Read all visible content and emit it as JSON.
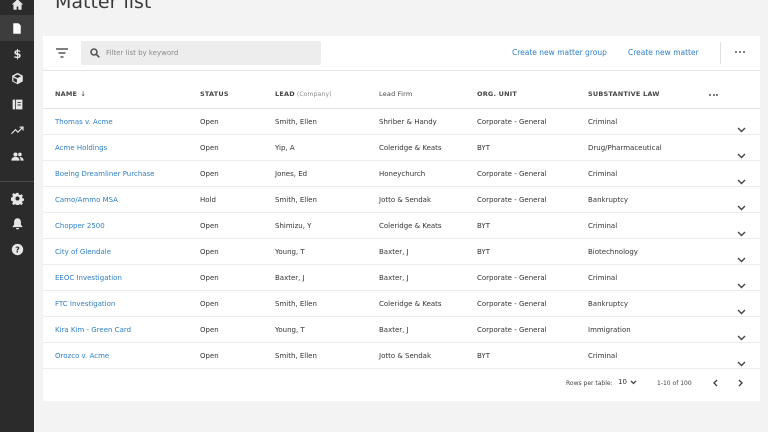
{
  "page": {
    "title": "Matter list"
  },
  "nav_rail": {
    "icons": [
      "home-icon",
      "document-icon",
      "dollar-icon",
      "cube-icon",
      "book-icon",
      "trend-icon",
      "people-icon",
      "gear-icon",
      "bell-icon",
      "help-icon"
    ],
    "active": "document-icon"
  },
  "toolbar": {
    "search_placeholder": "Filter list by keyword",
    "create_group_label": "Create new matter group",
    "create_matter_label": "Create new matter"
  },
  "table": {
    "columns": {
      "name": "NAME",
      "status": "STATUS",
      "lead": "LEAD",
      "lead_sub": "(Company)",
      "lead_firm": "Lead Firm",
      "org_unit": "ORG. UNIT",
      "substantive_law": "SUBSTANTIVE LAW"
    },
    "sort_indicator": "↓",
    "rows": [
      {
        "name": "Thomas v. Acme",
        "status": "Open",
        "lead": "Smith, Ellen",
        "lead_firm": "Shriber & Handy",
        "org_unit": "Corporate - General",
        "law": "Criminal"
      },
      {
        "name": "Acme Holdings",
        "status": "Open",
        "lead": "Yip, A",
        "lead_firm": "Coleridge & Keats",
        "org_unit": "BYT",
        "law": "Drug/Pharmaceutical"
      },
      {
        "name": "Boeing Dreamliner Purchase",
        "status": "Open",
        "lead": "Jones, Ed",
        "lead_firm": "Honeychurch",
        "org_unit": "Corporate - General",
        "law": "Criminal"
      },
      {
        "name": "Camo/Ammo MSA",
        "status": "Hold",
        "lead": "Smith, Ellen",
        "lead_firm": "Jotto & Sendak",
        "org_unit": "Corporate - General",
        "law": "Bankruptcy"
      },
      {
        "name": "Chopper 2500",
        "status": "Open",
        "lead": "Shimizu, Y",
        "lead_firm": "Coleridge & Keats",
        "org_unit": "BYT",
        "law": "Criminal"
      },
      {
        "name": "City of Glendale",
        "status": "Open",
        "lead": "Young, T",
        "lead_firm": "Baxter, J",
        "org_unit": "BYT",
        "law": "Biotechnology"
      },
      {
        "name": "EEOC Investigation",
        "status": "Open",
        "lead": "Baxter, J",
        "lead_firm": "Baxter, J",
        "org_unit": "Corporate - General",
        "law": "Criminal"
      },
      {
        "name": "FTC Investigation",
        "status": "Open",
        "lead": "Smith, Ellen",
        "lead_firm": "Coleridge & Keats",
        "org_unit": "Corporate - General",
        "law": "Bankruptcy"
      },
      {
        "name": "Kira Kim - Green Card",
        "status": "Open",
        "lead": "Young, T",
        "lead_firm": "Baxter, J",
        "org_unit": "Corporate - General",
        "law": "Immigration"
      },
      {
        "name": "Orozco v. Acme",
        "status": "Open",
        "lead": "Smith, Ellen",
        "lead_firm": "Jotto & Sendak",
        "org_unit": "BYT",
        "law": "Criminal"
      }
    ]
  },
  "pagination": {
    "rows_per_page_label": "Rows per table:",
    "rows_per_page_value": "10",
    "range_label": "1-10 of 100"
  },
  "colors": {
    "rail_background": "#2b2b2b",
    "link": "#2f7fc4",
    "page_background": "#f3f3f3"
  }
}
